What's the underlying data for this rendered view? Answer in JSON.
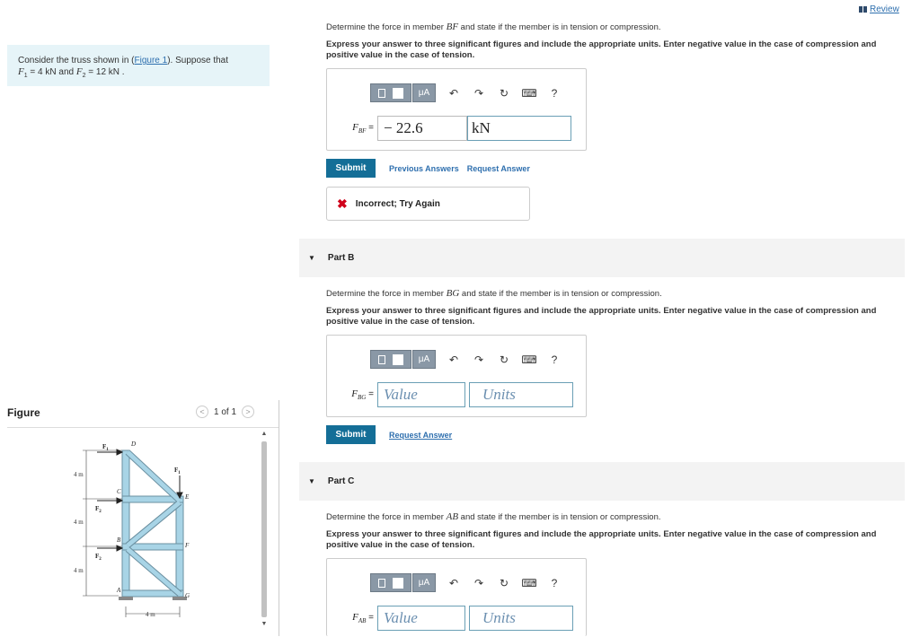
{
  "problem": {
    "intro": "Consider the truss shown in (",
    "figure_link": "Figure 1",
    "intro_end": "). Suppose that",
    "f1_sym": "F",
    "f1_sub": "1",
    "f1_eq": " = 4  kN and ",
    "f2_sym": "F",
    "f2_sub": "2",
    "f2_eq": " = 12  kN ."
  },
  "figure": {
    "label": "Figure",
    "pager": "1 of 1",
    "prev_glyph": "<",
    "next_glyph": ">",
    "dims": {
      "h1": "4 m",
      "h2": "4 m",
      "h3": "4 m",
      "w": "4 m"
    },
    "nodes": {
      "A": "A",
      "B": "B",
      "C": "C",
      "D": "D",
      "E": "E",
      "F": "F",
      "G": "G"
    },
    "loads": {
      "f1a": "F",
      "f1a_sub": "1",
      "f2a": "F",
      "f2a_sub": "2",
      "f2b": "F",
      "f2b_sub": "2",
      "f1b": "F",
      "f1b_sub": "1"
    }
  },
  "review": {
    "label": "Review"
  },
  "toolbar": {
    "mu": "μA",
    "undo": "↶",
    "redo": "↷",
    "reset": "↻",
    "keyboard": "⌨",
    "help": "?"
  },
  "partA": {
    "question_pre": "Determine the force in member ",
    "member": "BF",
    "question_post": " and state if the member is in tension or compression.",
    "instructions": "Express your answer to three significant figures and include the appropriate units. Enter negative value in the case of compression and positive value in the case of tension.",
    "field_sym": "F",
    "field_sub": "BF",
    "eq": " =",
    "value": "− 22.6",
    "unit": "kN",
    "submit": "Submit",
    "previous_answers": "Previous Answers",
    "request_answer": "Request Answer",
    "feedback": "Incorrect; Try Again"
  },
  "partB": {
    "title": "Part B",
    "question_pre": "Determine the force in member ",
    "member": "BG",
    "question_post": " and state if the member is in tension or compression.",
    "instructions": "Express your answer to three significant figures and include the appropriate units. Enter negative value in the case of compression and positive value in the case of tension.",
    "field_sym": "F",
    "field_sub": "BG",
    "eq": " =",
    "value_placeholder": "Value",
    "unit_placeholder": "Units",
    "submit": "Submit",
    "request_answer": "Request Answer"
  },
  "partC": {
    "title": "Part C",
    "question_pre": "Determine the force in member ",
    "member": "AB",
    "question_post": " and state if the member is in tension or compression.",
    "instructions": "Express your answer to three significant figures and include the appropriate units. Enter negative value in the case of compression and positive value in the case of tension.",
    "field_sym": "F",
    "field_sub": "AB",
    "eq": " =",
    "value_placeholder": "Value",
    "unit_placeholder": "Units"
  },
  "colors": {
    "accent": "#146e97",
    "link": "#2e6fae",
    "member": "#a8d4e6",
    "error": "#d0021b"
  }
}
